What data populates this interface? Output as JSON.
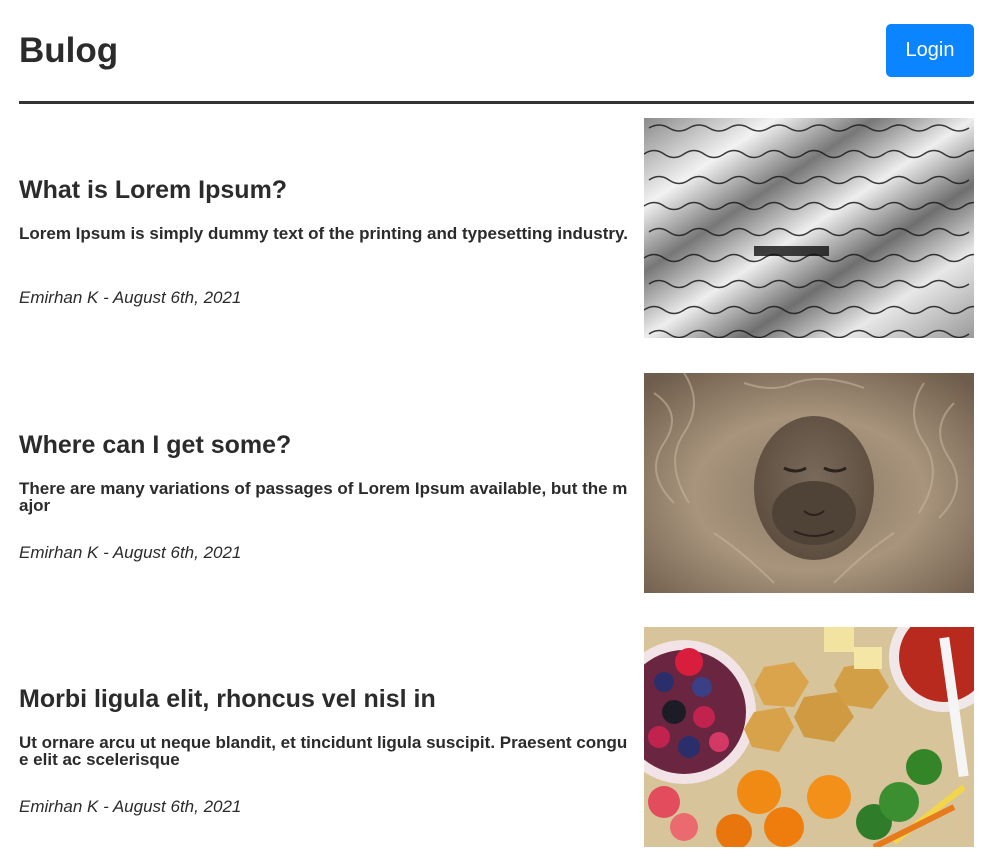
{
  "header": {
    "brand": "Bulog",
    "login_label": "Login"
  },
  "posts": [
    {
      "title": "What is Lorem Ipsum?",
      "excerpt": "Lorem Ipsum is simply dummy text of the printing and typesetting industry.",
      "meta": "Emirhan K - August 6th, 2021",
      "image": "handwriting-photo"
    },
    {
      "title": "Where can I get some?",
      "excerpt": "There are many variations of passages of Lorem Ipsum available, but the major",
      "meta": "Emirhan K - August 6th, 2021",
      "image": "alpaca-photo"
    },
    {
      "title": "Morbi ligula elit, rhoncus vel nisl in",
      "excerpt": "Ut ornare arcu ut neque blandit, et tincidunt ligula suscipit. Praesent congue elit ac scelerisque",
      "meta": "Emirhan K - August 6th, 2021",
      "image": "food-platter-photo"
    }
  ],
  "colors": {
    "accent": "#0a84ff",
    "text": "#2b2b2b",
    "divider": "#333333"
  }
}
